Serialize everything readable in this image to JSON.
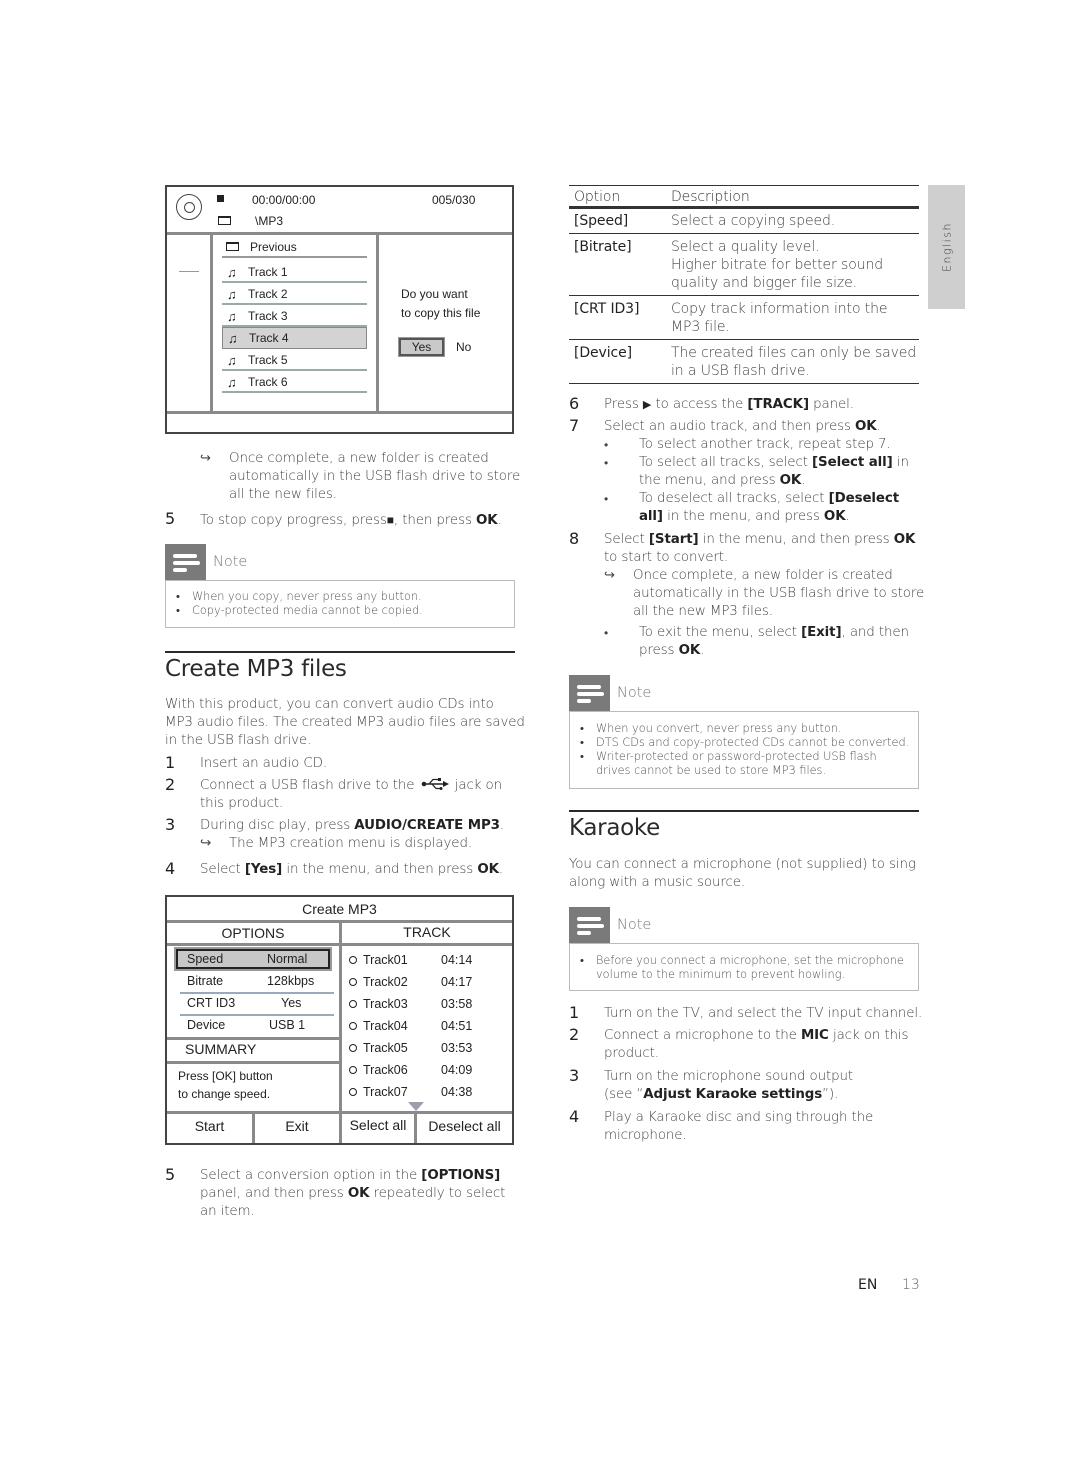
{
  "copy_screen": {
    "time": "00:00/00:00",
    "count": "005/030",
    "folder": "\\MP3",
    "previous": "Previous",
    "tracks": [
      "Track 1",
      "Track 2",
      "Track 3",
      "Track 4",
      "Track 5",
      "Track 6"
    ],
    "selected_track": "Track 4",
    "prompt_line1": "Do you want",
    "prompt_line2": "to copy this file",
    "yes": "Yes",
    "no": "No"
  },
  "left_col": {
    "copy_result": {
      "arrow": "↪",
      "line1": "Once complete, a new folder is created",
      "line2": "automatically in the USB flash drive to store",
      "line3": "all the new files."
    },
    "step5_copy": {
      "num": "5",
      "pre": "To stop copy progress, press",
      "stop_glyph": "■",
      "mid": ", then press",
      "ok": "OK",
      "post": "."
    },
    "note1": {
      "title": "Note",
      "items": [
        "When you copy, never press any button.",
        "Copy-protected media cannot be copied."
      ]
    },
    "create_mp3": {
      "heading": "Create MP3 files",
      "intro1": "With this product, you can convert audio CDs into",
      "intro2": "MP3 audio files. The created MP3 audio files are saved",
      "intro3": "in the USB flash drive.",
      "steps": [
        {
          "num": "1",
          "text": "Insert an audio CD."
        },
        {
          "num": "2",
          "pre": "Connect a USB flash drive to the",
          "icon": "usb-icon",
          "post": "jack on",
          "line2": "this product."
        },
        {
          "num": "3",
          "pre": "During disc play, press",
          "bold": "AUDIO/CREATE MP3",
          "post": ".",
          "sub": "The MP3 creation menu is displayed."
        },
        {
          "num": "4",
          "pre": "Select",
          "bold": "[Yes]",
          "mid": "in the menu, and then press",
          "bold2": "OK",
          "post": "."
        }
      ],
      "step5": {
        "num": "5",
        "pre": "Select a conversion option in the",
        "bold": "[OPTIONS]",
        "line2_pre": "panel, and then press",
        "bold2": "OK",
        "line2_post": "repeatedly to select",
        "line3": "an item."
      }
    }
  },
  "mp3_screen": {
    "title": "Create MP3",
    "options_header": "OPTIONS",
    "track_header": "TRACK",
    "options": [
      {
        "label": "Speed",
        "value": "Normal"
      },
      {
        "label": "Bitrate",
        "value": "128kbps"
      },
      {
        "label": "CRT ID3",
        "value": "Yes"
      },
      {
        "label": "Device",
        "value": "USB 1"
      }
    ],
    "summary_header": "SUMMARY",
    "summary_line1": "Press [OK] button",
    "summary_line2": "to change speed.",
    "tracks": [
      {
        "name": "Track01",
        "time": "04:14"
      },
      {
        "name": "Track02",
        "time": "04:17"
      },
      {
        "name": "Track03",
        "time": "03:58"
      },
      {
        "name": "Track04",
        "time": "04:51"
      },
      {
        "name": "Track05",
        "time": "03:53"
      },
      {
        "name": "Track06",
        "time": "04:09"
      },
      {
        "name": "Track07",
        "time": "04:38"
      }
    ],
    "buttons": {
      "start": "Start",
      "exit": "Exit",
      "select_all": "Select all",
      "deselect_all": "Deselect all"
    }
  },
  "options_table": {
    "headers": [
      "Option",
      "Description"
    ],
    "rows": [
      {
        "option": "[Speed]",
        "desc": [
          "Select a copying speed."
        ]
      },
      {
        "option": "[Bitrate]",
        "desc": [
          "Select a quality level.",
          "Higher bitrate for better sound",
          "quality and bigger file size."
        ]
      },
      {
        "option": "[CRT ID3]",
        "desc": [
          "Copy track information into the",
          "MP3 file."
        ]
      },
      {
        "option": "[Device]",
        "desc": [
          "The created files can only be saved",
          "in a USB flash drive."
        ]
      }
    ]
  },
  "side_tab": "English",
  "right_col": {
    "step6": {
      "num": "6",
      "pre": "Press",
      "glyph": "▶",
      "mid": "to access the",
      "bold": "[TRACK]",
      "post": "panel."
    },
    "step7": {
      "num": "7",
      "pre": "Select an audio track, and then press",
      "bold": "OK",
      "post": ".",
      "bullets": [
        {
          "l1": "To select another track, repeat step 7."
        },
        {
          "l1_pre": "To select all tracks, select",
          "l1_bold": "[Select all]",
          "l1_post": "in",
          "l2_pre": "the menu, and press",
          "l2_bold": "OK",
          "l2_post": "."
        },
        {
          "l1_pre": "To deselect all tracks, select",
          "l1_bold": "[Deselect",
          "l2_bold0": "all]",
          "l2_pre": "in the menu, and press",
          "l2_bold": "OK",
          "l2_post": "."
        }
      ]
    },
    "step8": {
      "num": "8",
      "pre": "Select",
      "bold": "[Start]",
      "mid": "in the menu, and then press",
      "bold2": "OK",
      "line2": "to start to convert.",
      "sub1": "Once complete, a new folder is created",
      "sub2": "automatically in the USB flash drive to store",
      "sub3": "all the new MP3 files.",
      "bullet_pre": "To exit the menu, select",
      "bullet_bold": "[Exit]",
      "bullet_post": ", and then",
      "bullet_l2_pre": "press",
      "bullet_l2_bold": "OK",
      "bullet_l2_post": "."
    },
    "note2": {
      "title": "Note",
      "items": [
        [
          "When you convert, never press any button."
        ],
        [
          "DTS CDs and copy-protected CDs cannot be converted."
        ],
        [
          "Writer-protected or password-protected USB flash",
          "drives cannot be used to store MP3 files."
        ]
      ]
    },
    "karaoke": {
      "heading": "Karaoke",
      "intro1": "You can connect a microphone (not supplied) to sing",
      "intro2": "along with a music source.",
      "note": {
        "title": "Note",
        "l1": "Before you connect a microphone, set the microphone",
        "l2": "volume to the minimum to prevent howling."
      },
      "steps": [
        {
          "num": "1",
          "text": "Turn on the TV, and select the TV input channel."
        },
        {
          "num": "2",
          "pre": "Connect a microphone to the",
          "bold": "MIC",
          "post": "jack on this",
          "line2": "product."
        },
        {
          "num": "3",
          "text": "Turn on the microphone sound output",
          "l2_pre": "(see “",
          "l2_bold": "Adjust Karaoke settings",
          "l2_post": "”)."
        },
        {
          "num": "4",
          "text": "Play a Karaoke disc and sing through the",
          "line2": "microphone."
        }
      ]
    }
  },
  "footer": {
    "lang": "EN",
    "page": "13"
  }
}
